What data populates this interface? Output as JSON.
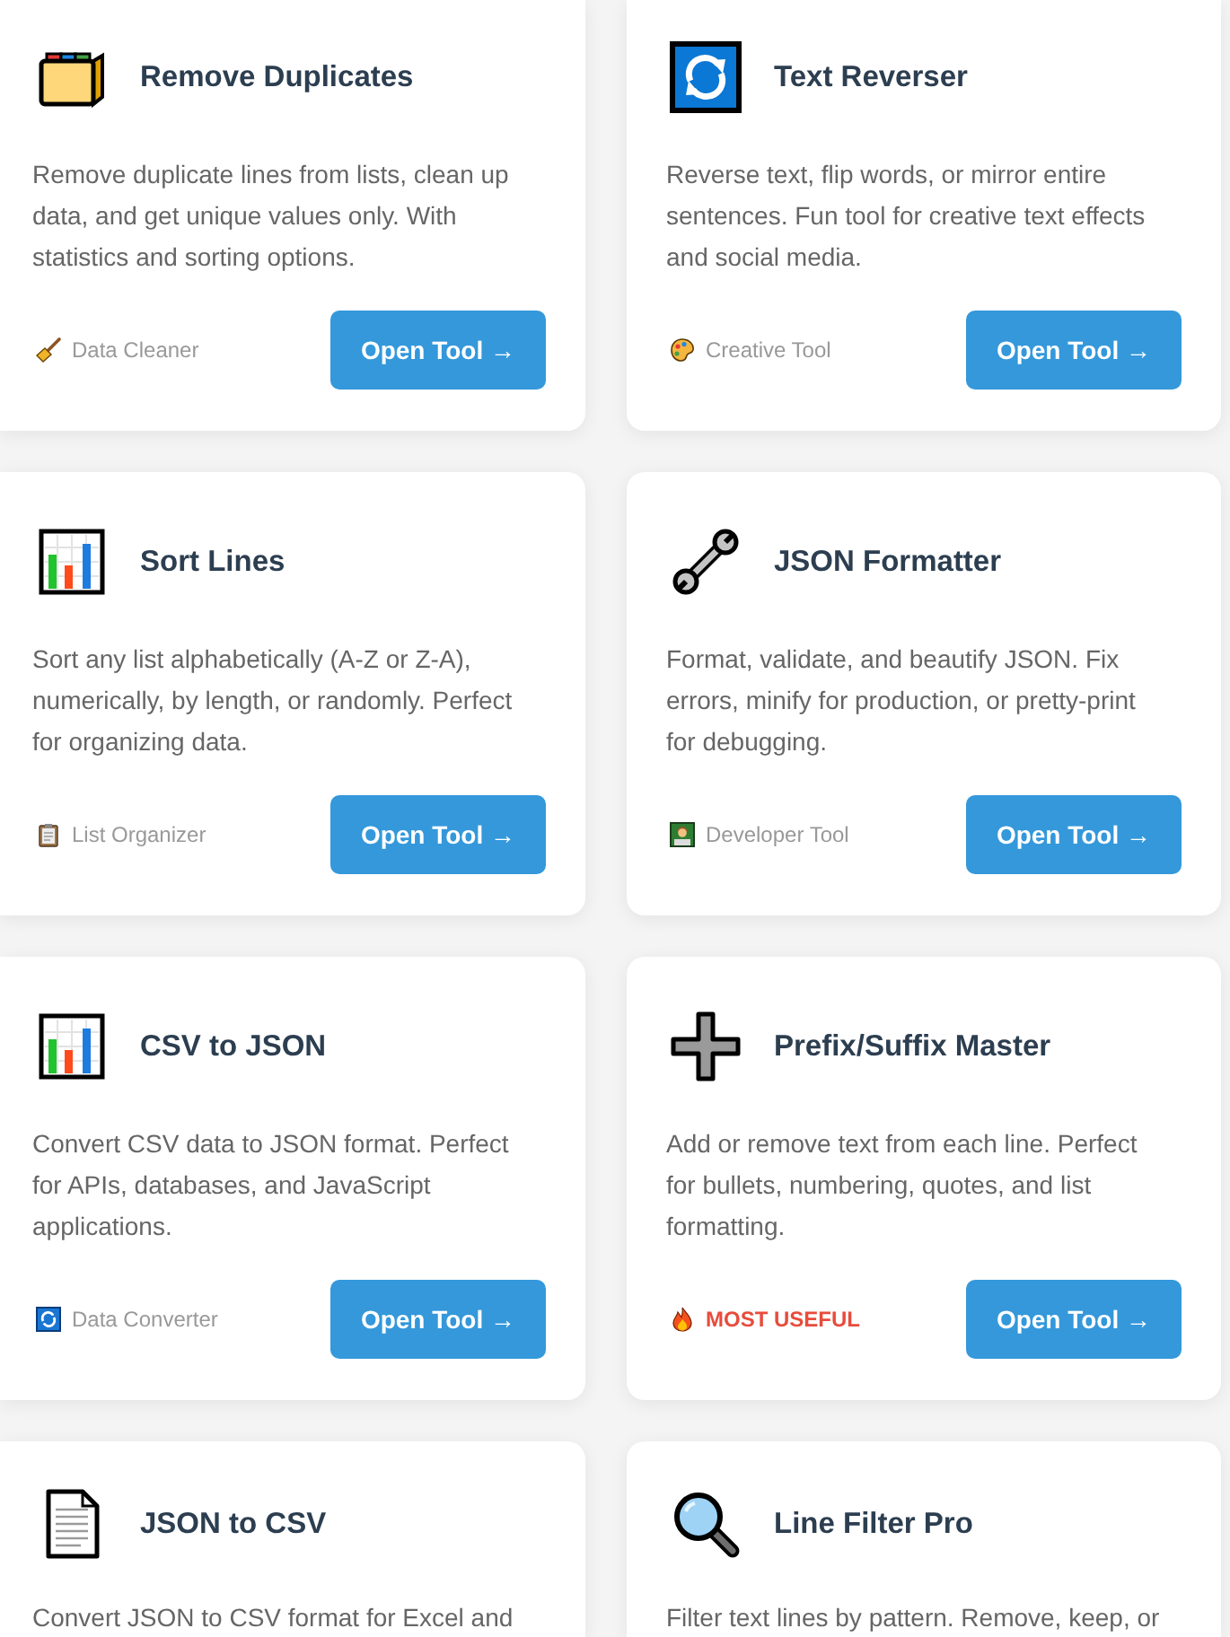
{
  "cards": [
    {
      "title": "Remove Duplicates",
      "description": "Remove duplicate lines from lists, clean up data, and get unique values only. With statistics and sorting options.",
      "tag": {
        "kind": "category",
        "text": "Data Cleaner"
      },
      "button": "Open Tool →"
    },
    {
      "title": "Text Reverser",
      "description": "Reverse text, flip words, or mirror entire sentences. Fun tool for creative text effects and social media.",
      "tag": {
        "kind": "category",
        "text": "Creative Tool"
      },
      "button": "Open Tool →"
    },
    {
      "title": "Sort Lines",
      "description": "Sort any list alphabetically (A-Z or Z-A), numerically, by length, or randomly. Perfect for organizing data.",
      "tag": {
        "kind": "category",
        "text": "List Organizer"
      },
      "button": "Open Tool →"
    },
    {
      "title": "JSON Formatter",
      "description": "Format, validate, and beautify JSON. Fix errors, minify for production, or pretty-print for debugging.",
      "tag": {
        "kind": "category",
        "text": "Developer Tool"
      },
      "button": "Open Tool →"
    },
    {
      "title": "CSV to JSON",
      "description": "Convert CSV data to JSON format. Perfect for APIs, databases, and JavaScript applications.",
      "tag": {
        "kind": "category",
        "text": "Data Converter"
      },
      "button": "Open Tool →"
    },
    {
      "title": "Prefix/Suffix Master",
      "description": "Add or remove text from each line. Perfect for bullets, numbering, quotes, and list formatting.",
      "tag": {
        "kind": "highlight",
        "text": "MOST USEFUL"
      },
      "button": "Open Tool →"
    },
    {
      "title": "JSON to CSV",
      "description": "Convert JSON to CSV format for Excel and"
    },
    {
      "title": "Line Filter Pro",
      "description": "Filter text lines by pattern. Remove, keep, or"
    }
  ]
}
